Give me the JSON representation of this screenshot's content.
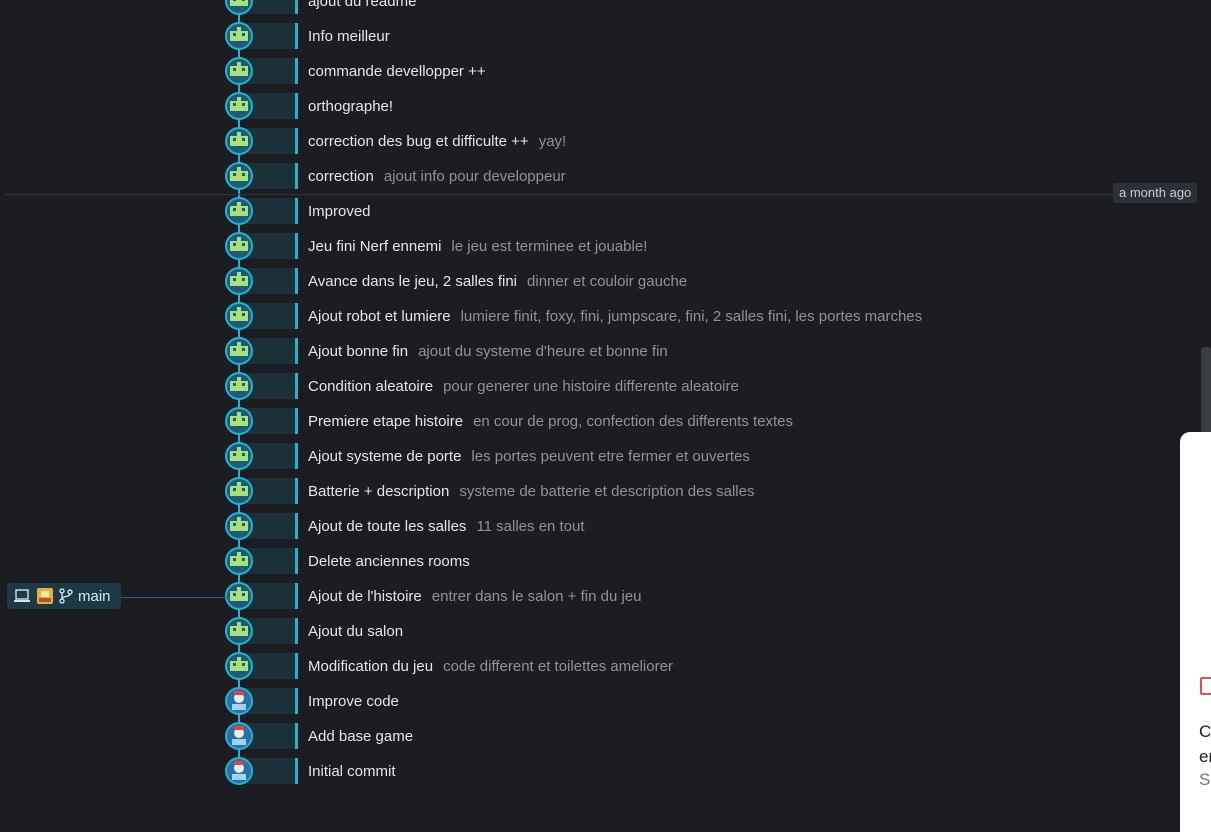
{
  "timestamp": "a month ago",
  "branch": {
    "name": "main",
    "icons": [
      "laptop-icon",
      "avatar",
      "branch-icon"
    ]
  },
  "commits": [
    {
      "message": "ajout du readme",
      "description": "",
      "avatar": "robot"
    },
    {
      "message": "Info meilleur",
      "description": "",
      "avatar": "robot"
    },
    {
      "message": "commande devellopper ++",
      "description": "",
      "avatar": "robot"
    },
    {
      "message": "orthographe!",
      "description": "",
      "avatar": "robot"
    },
    {
      "message": "correction des bug et difficulte ++",
      "description": "yay!",
      "avatar": "robot"
    },
    {
      "message": "correction",
      "description": "ajout info pour developpeur",
      "avatar": "robot"
    },
    {
      "message": "Improved",
      "description": "",
      "avatar": "robot"
    },
    {
      "message": "Jeu fini Nerf ennemi",
      "description": "le jeu est terminee et jouable!",
      "avatar": "robot"
    },
    {
      "message": "Avance dans le jeu, 2 salles fini",
      "description": "dinner et couloir gauche",
      "avatar": "robot"
    },
    {
      "message": "Ajout robot et lumiere",
      "description": "lumiere finit, foxy, fini, jumpscare, fini, 2 salles fini, les portes marches",
      "avatar": "robot"
    },
    {
      "message": "Ajout bonne fin",
      "description": "ajout du systeme d'heure et bonne fin",
      "avatar": "robot"
    },
    {
      "message": "Condition aleatoire",
      "description": "pour generer une histoire differente aleatoire",
      "avatar": "robot"
    },
    {
      "message": "Premiere etape histoire",
      "description": "en cour de prog, confection des differents textes",
      "avatar": "robot"
    },
    {
      "message": "Ajout systeme de porte",
      "description": "les portes peuvent etre fermer et ouvertes",
      "avatar": "robot"
    },
    {
      "message": "Batterie + description",
      "description": "systeme de batterie et description des salles",
      "avatar": "robot"
    },
    {
      "message": "Ajout de toute les salles",
      "description": "11 salles en tout",
      "avatar": "robot"
    },
    {
      "message": "Delete anciennes rooms",
      "description": "",
      "avatar": "robot"
    },
    {
      "message": "Ajout de l'histoire",
      "description": "entrer dans le salon + fin du jeu",
      "avatar": "robot"
    },
    {
      "message": "Ajout du salon",
      "description": "",
      "avatar": "robot"
    },
    {
      "message": "Modification du jeu",
      "description": "code different et toilettes ameliorer",
      "avatar": "robot"
    },
    {
      "message": "Improve code",
      "description": "",
      "avatar": "person"
    },
    {
      "message": "Add base game",
      "description": "",
      "avatar": "person"
    },
    {
      "message": "Initial commit",
      "description": "",
      "avatar": "person"
    }
  ],
  "colors": {
    "accent": "#21b3cf",
    "background": "#1b1d22",
    "branch_bg": "#1d3a44",
    "robot": "#a8e07a"
  },
  "side_panel": {
    "line1": "C",
    "line2": "er",
    "line3": "Se"
  }
}
